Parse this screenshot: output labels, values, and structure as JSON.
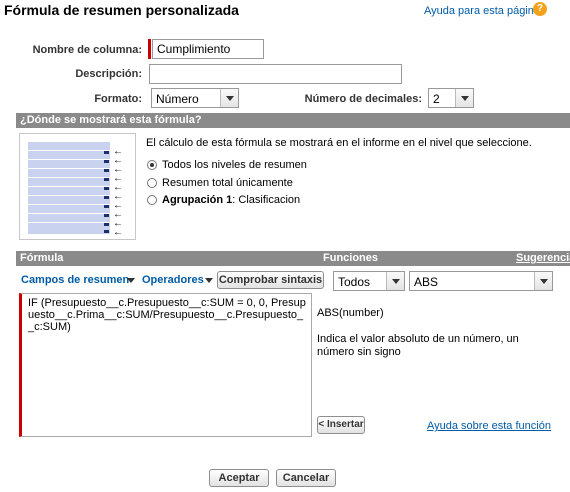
{
  "header": {
    "title": "Fórmula de resumen personalizada",
    "help_link": "Ayuda para esta página",
    "help_icon": "help-icon"
  },
  "form": {
    "column_name_label": "Nombre de columna:",
    "column_name_value": "Cumplimiento",
    "description_label": "Descripción:",
    "description_value": "",
    "format_label": "Formato:",
    "format_value": "Número",
    "decimals_label": "Número de decimales:",
    "decimals_value": "2"
  },
  "display_section": {
    "header": "¿Dónde se mostrará esta fórmula?",
    "description": "El cálculo de esta fórmula se mostrará en el informe en el nivel que seleccione.",
    "options": [
      {
        "label": "Todos los niveles de resumen",
        "checked": true
      },
      {
        "label": "Resumen total únicamente",
        "checked": false
      },
      {
        "bold_label": "Agrupación 1",
        "label": ": Clasificacion",
        "checked": false
      }
    ]
  },
  "formula_section": {
    "header_formula": "Fórmula",
    "header_functions": "Funciones",
    "suggestions_link": "Sugerencias",
    "summary_fields": "Campos de resumen",
    "operators": "Operadores",
    "check_syntax": "Comprobar sintaxis",
    "category_value": "Todos",
    "function_value": "ABS",
    "formula_text": "IF (Presupuesto__c.Presupuesto__c:SUM = 0, 0, Presupuesto__c.Prima__c:SUM/Presupuesto__c.Presupuesto__c:SUM)",
    "function_signature": "ABS(number)",
    "function_description": "Indica el valor absoluto de un número, un número sin signo",
    "insert_button": "< Insertar",
    "function_help": "Ayuda sobre esta función"
  },
  "footer": {
    "accept": "Aceptar",
    "cancel": "Cancelar"
  },
  "colors": {
    "link": "#015ba7",
    "section_header": "#8a8a8a",
    "required": "#cc0000",
    "help_icon": "#f4a11b"
  }
}
